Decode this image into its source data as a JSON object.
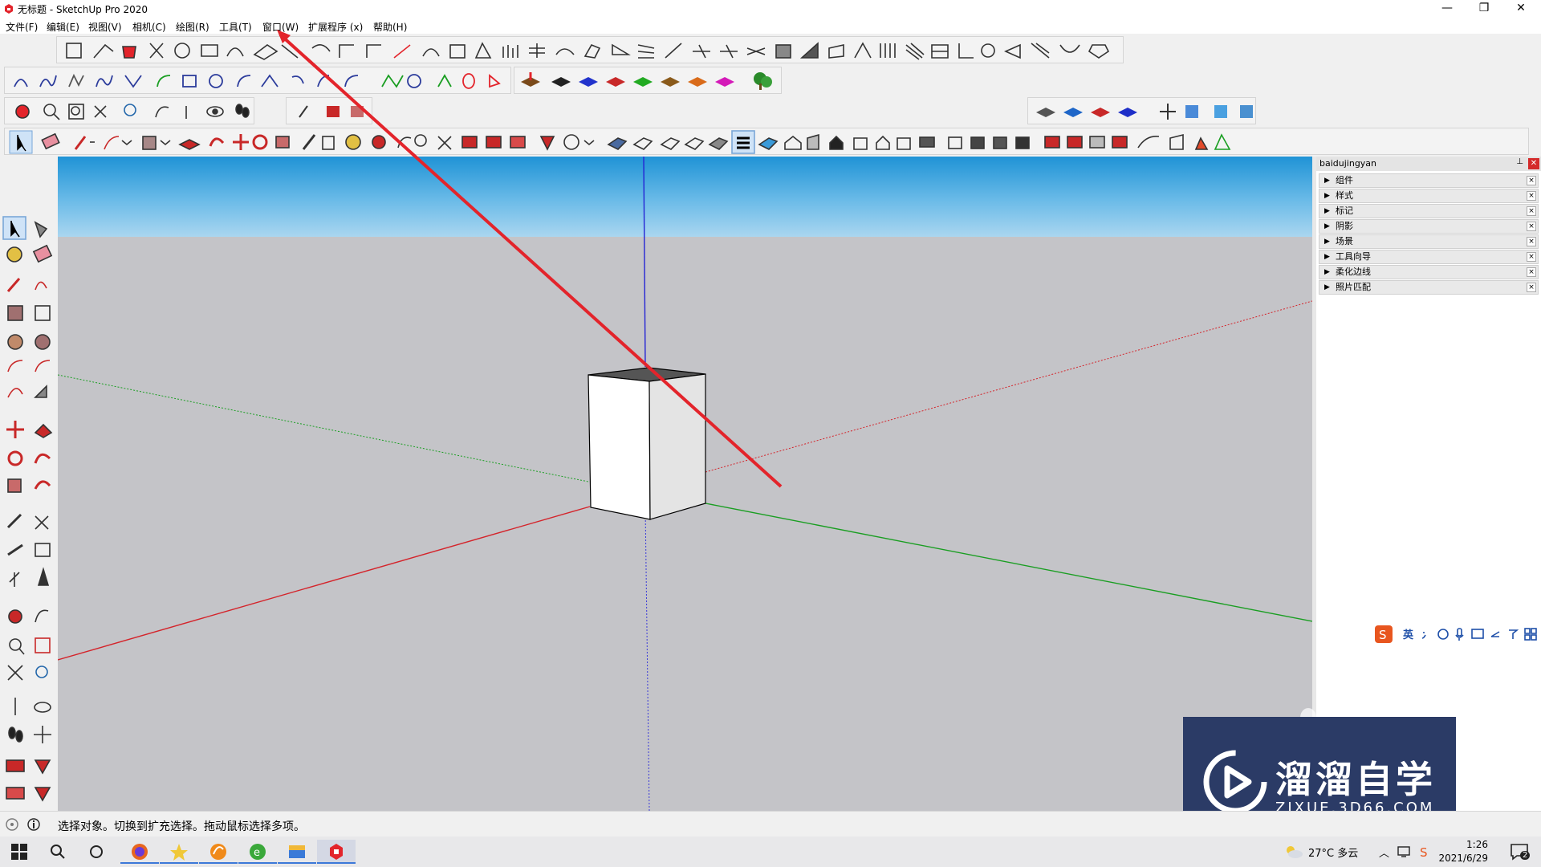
{
  "window": {
    "title": "无标题 - SketchUp Pro 2020",
    "controls": {
      "minimize": "—",
      "restore": "❐",
      "close": "✕"
    }
  },
  "menu": [
    "文件(F)",
    "编辑(E)",
    "视图(V)",
    "相机(C)",
    "绘图(R)",
    "工具(T)",
    "窗口(W)",
    "扩展程序 (x)",
    "帮助(H)"
  ],
  "tray": {
    "title": "baidujingyan",
    "panels": [
      "组件",
      "样式",
      "标记",
      "阴影",
      "场景",
      "工具向导",
      "柔化边线",
      "照片匹配"
    ]
  },
  "ime": {
    "lang": "英",
    "brand_icon": "sogou-icon"
  },
  "watermark": {
    "title": "溜溜自学",
    "subtitle": "ZIXUE.3D66.COM"
  },
  "status": {
    "message": "选择对象。切换到扩充选择。拖动鼠标选择多项。"
  },
  "taskbar": {
    "weather": "27°C 多云",
    "time": "1:26",
    "date": "2021/6/29",
    "notifications": "2"
  },
  "colors": {
    "accent_red": "#e3242b",
    "axis_red": "#d4242b",
    "axis_green": "#1a9e22",
    "axis_blue": "#2424d4",
    "watermark_bg": "#2b3b66"
  }
}
